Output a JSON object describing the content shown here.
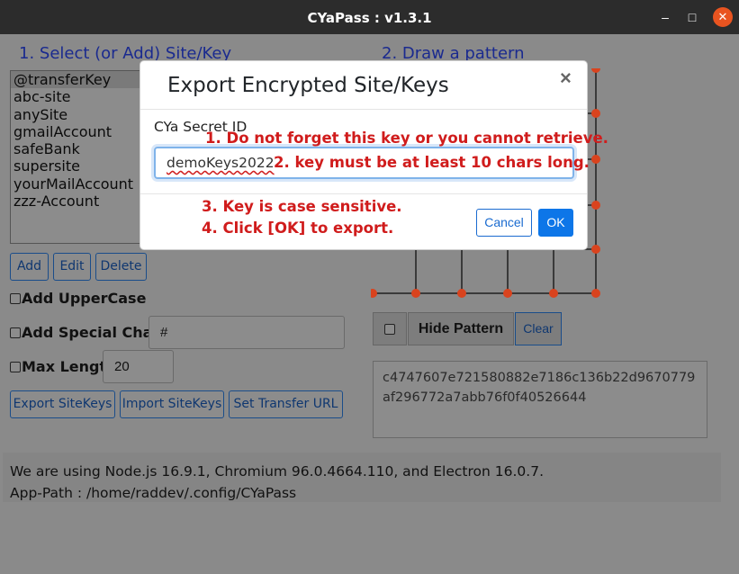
{
  "window": {
    "title": "CYaPass : v1.3.1",
    "minimize_glyph": "–",
    "maximize_glyph": "□",
    "close_glyph": "✕"
  },
  "left": {
    "heading": "1. Select (or Add) Site/Key",
    "sites": [
      "@transferKey",
      "abc-site",
      "anySite",
      "gmailAccount",
      "safeBank",
      "supersite",
      "yourMailAccount",
      "zzz-Account"
    ],
    "add_label": "Add",
    "edit_label": "Edit",
    "delete_label": "Delete",
    "uppercase_label": "Add UpperCase",
    "special_label": "Add Special Chars",
    "special_value": "#",
    "maxlength_label": "Max Length",
    "maxlength_value": "20",
    "export_label": "Export SiteKeys",
    "import_label": "Import SiteKeys",
    "transfer_label": "Set Transfer URL"
  },
  "right": {
    "heading": "2. Draw a pattern",
    "hide_pattern_label": "Hide Pattern",
    "clear_label": "Clear",
    "hash_value": "c4747607e721580882e7186c136b22d9670779af296772a7abb76f0f40526644"
  },
  "info": {
    "line1": "We are using Node.js 16.9.1, Chromium 96.0.4664.110, and Electron 16.0.7.",
    "line2": "App-Path : /home/raddev/.config/CYaPass"
  },
  "modal": {
    "title": "Export Encrypted Site/Keys",
    "close_glyph": "×",
    "field_label": "CYa Secret ID",
    "field_value": "demoKeys2022",
    "cancel_label": "Cancel",
    "ok_label": "OK"
  },
  "notes": {
    "n1": "1. Do not forget this key or you cannot retrieve.",
    "n2": "2. key must be at least 10 chars long.",
    "n3": "3. Key is case sensitive.",
    "n4": "4. Click [OK] to export."
  },
  "colors": {
    "accent": "#0d76e8",
    "note_red": "#d01c1c",
    "grid_dot": "#d9431e"
  }
}
